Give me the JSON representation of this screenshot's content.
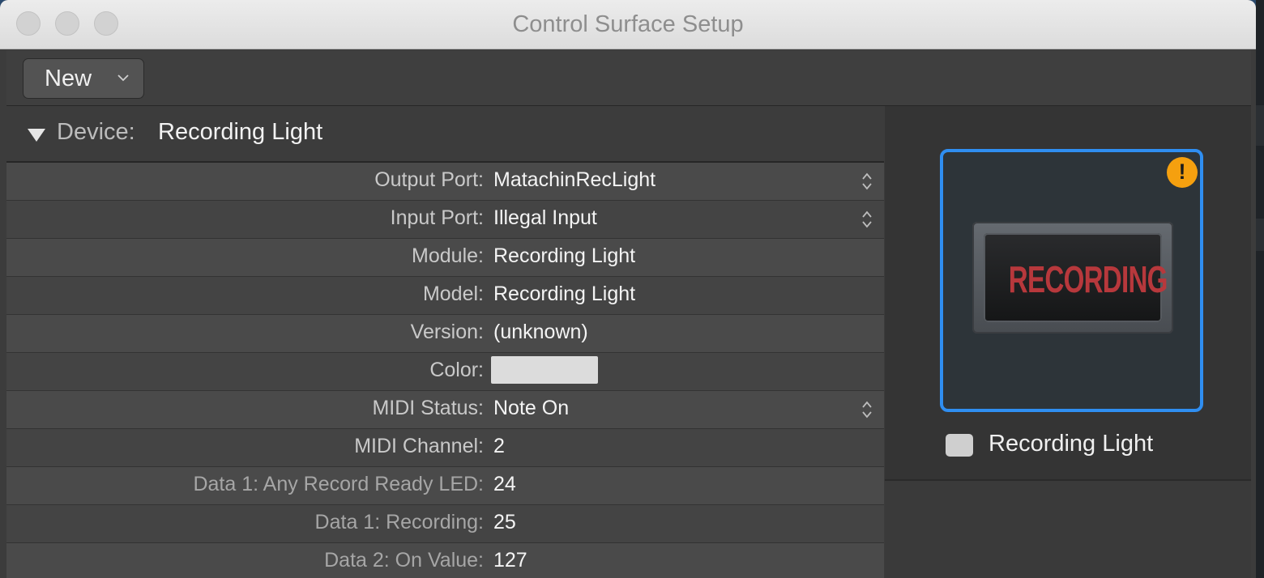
{
  "window": {
    "title": "Control Surface Setup"
  },
  "toolbar": {
    "new_label": "New"
  },
  "device_header": {
    "label": "Device:",
    "value": "Recording Light"
  },
  "settings": [
    {
      "label": "Output Port:",
      "value": "MatachinRecLight",
      "type": "popup"
    },
    {
      "label": "Input Port:",
      "value": "Illegal Input",
      "type": "popup"
    },
    {
      "label": "Module:",
      "value": "Recording Light",
      "type": "text"
    },
    {
      "label": "Model:",
      "value": "Recording Light",
      "type": "text"
    },
    {
      "label": "Version:",
      "value": "(unknown)",
      "type": "text"
    },
    {
      "label": "Color:",
      "value": "",
      "type": "color",
      "color": "#dcdcdc"
    },
    {
      "label": "MIDI Status:",
      "value": "Note On",
      "type": "popup"
    },
    {
      "label": "MIDI Channel:",
      "value": "2",
      "type": "text"
    },
    {
      "label": "Data 1: Any Record Ready LED:",
      "value": "24",
      "type": "text"
    },
    {
      "label": "Data 1: Recording:",
      "value": "25",
      "type": "text"
    },
    {
      "label": "Data 2: On Value:",
      "value": "127",
      "type": "text"
    }
  ],
  "device_tile": {
    "display_text": "RECORDING",
    "name": "Recording Light",
    "warning_icon": "exclamation-warning-icon",
    "selected": true
  },
  "colors": {
    "accent": "#2f8ef1",
    "warning": "#f5a00f",
    "recording_text": "#b7383c"
  }
}
